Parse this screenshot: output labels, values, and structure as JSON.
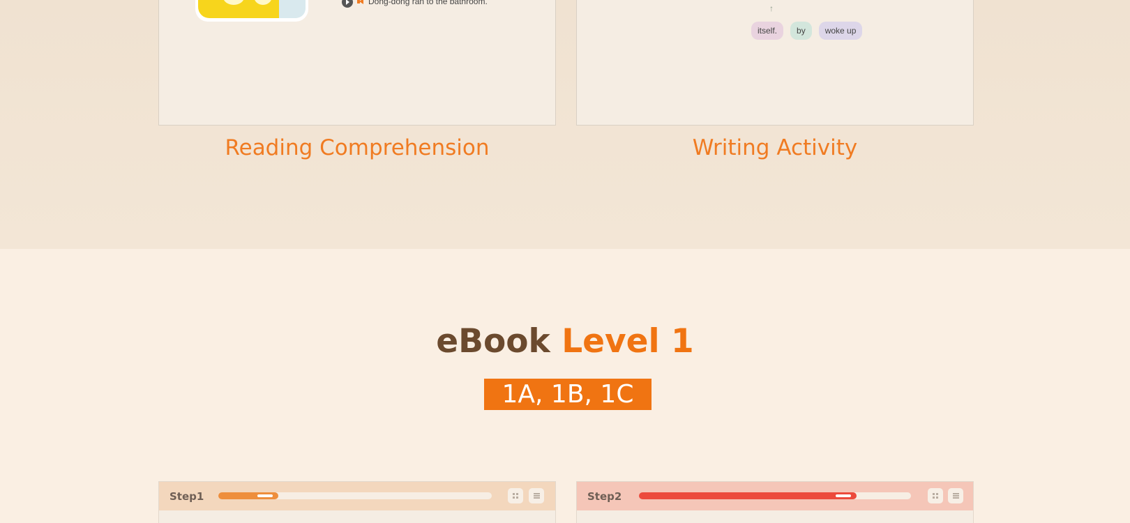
{
  "reading": {
    "sentence": "Dong-dong ran to the bathroom.",
    "caption": "Reading Comprehension"
  },
  "writing": {
    "caption": "Writing Activity",
    "arrow": "↑",
    "chips": [
      {
        "label": "itself.",
        "color": "#e9d3df"
      },
      {
        "label": "by",
        "color": "#d3e6dc"
      },
      {
        "label": "woke up",
        "color": "#ddd6e9"
      }
    ]
  },
  "ebook": {
    "title_part1": "eBook",
    "title_part2": "Level 1",
    "levels": "1A, 1B, 1C"
  },
  "steps": [
    {
      "label": "Step1",
      "progress": 0.22,
      "color": "#ee8e3c"
    },
    {
      "label": "Step2",
      "progress": 0.8,
      "color": "#ec4a3c"
    }
  ],
  "colors": {
    "accent": "#f07412",
    "brown": "#6b4a2e"
  }
}
